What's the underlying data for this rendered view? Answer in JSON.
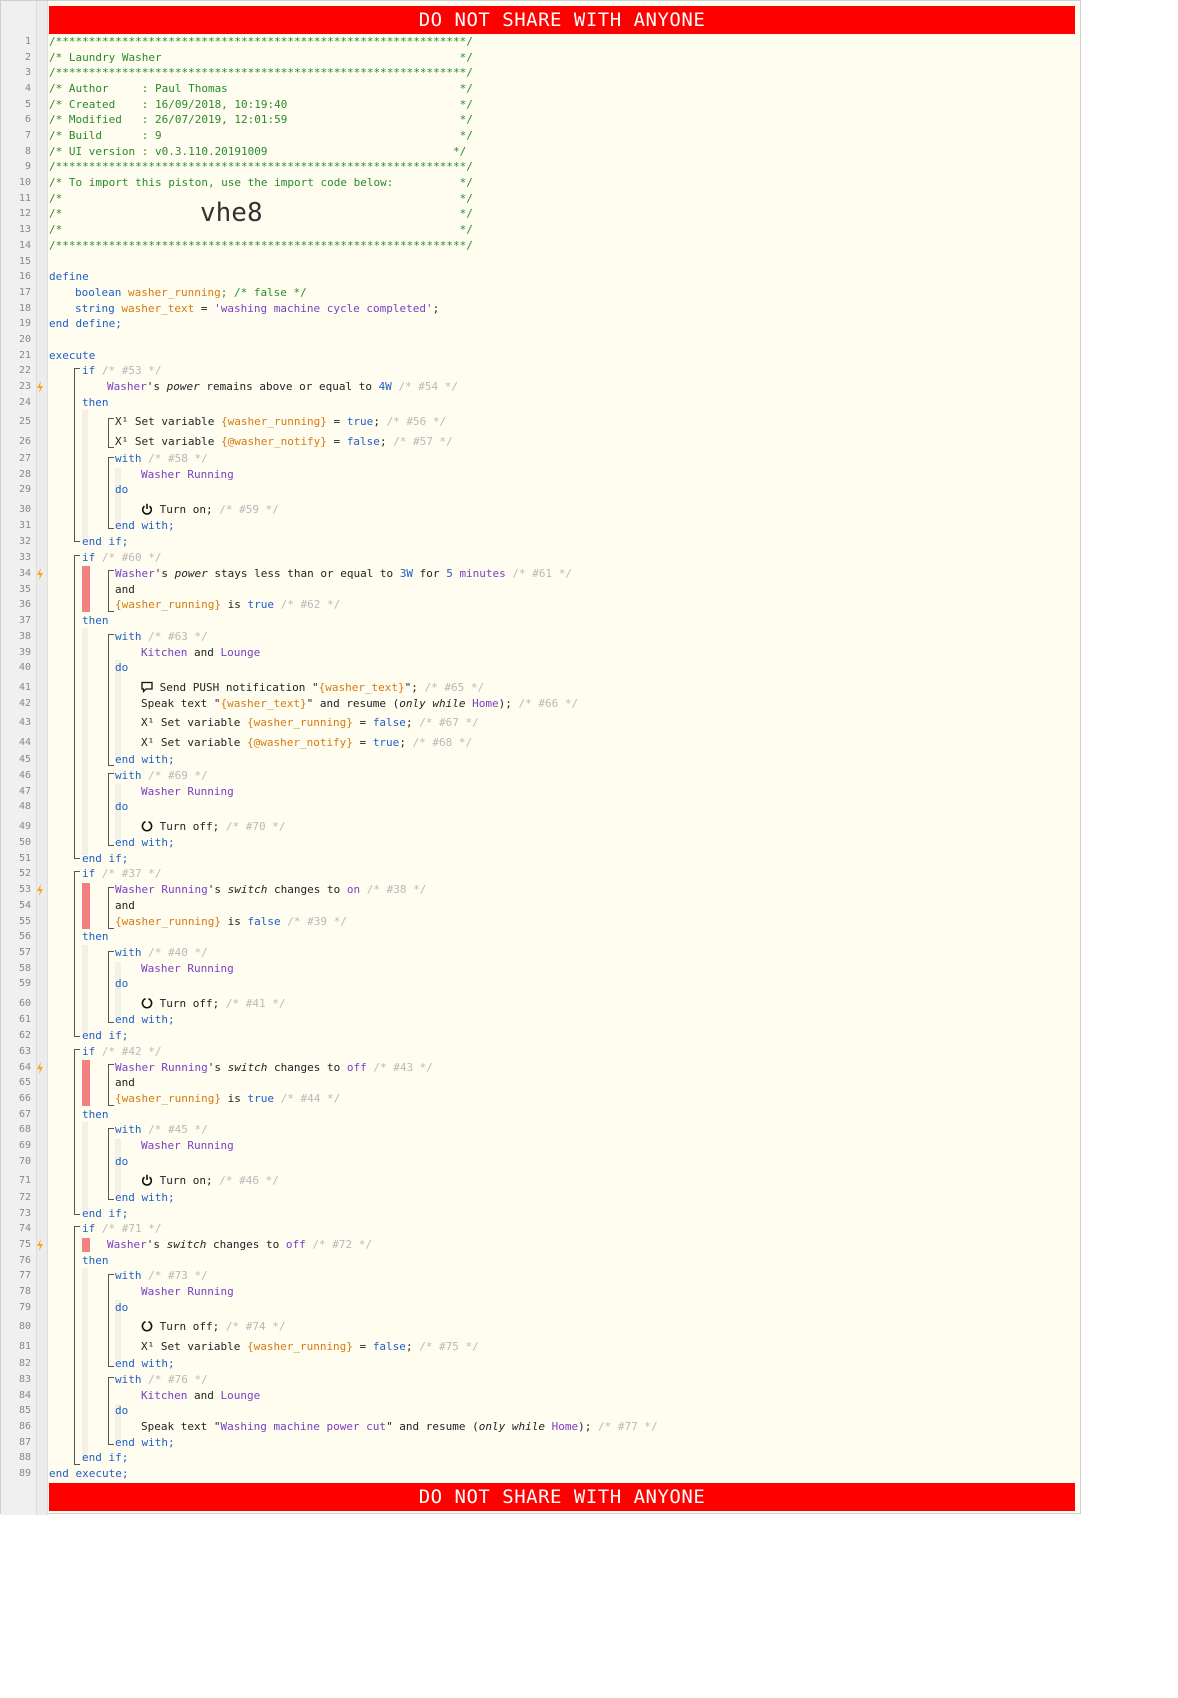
{
  "banner": {
    "text": "DO NOT SHARE WITH ANYONE"
  },
  "import_code": "vhe8",
  "line_numbers": [
    "1",
    "2",
    "3",
    "4",
    "5",
    "6",
    "7",
    "8",
    "9",
    "10",
    "11",
    "12",
    "13",
    "14",
    "15",
    "16",
    "17",
    "18",
    "19",
    "20",
    "21",
    "22",
    "23",
    "24",
    "25",
    "26",
    "27",
    "28",
    "29",
    "30",
    "31",
    "32",
    "33",
    "34",
    "35",
    "36",
    "37",
    "38",
    "39",
    "40",
    "41",
    "42",
    "43",
    "44",
    "45",
    "46",
    "47",
    "48",
    "49",
    "50",
    "51",
    "52",
    "53",
    "54",
    "55",
    "56",
    "57",
    "58",
    "59",
    "60",
    "61",
    "62",
    "63",
    "64",
    "65",
    "66",
    "67",
    "68",
    "69",
    "70",
    "71",
    "72",
    "73",
    "74",
    "75",
    "76",
    "77",
    "78",
    "79",
    "80",
    "81",
    "82",
    "83",
    "84",
    "85",
    "86",
    "87",
    "88",
    "89"
  ],
  "header": {
    "border": "/**************************************************************/",
    "title": "/* Laundry Washer                                             */",
    "author": "/* Author     : Paul Thomas                                   */",
    "created": "/* Created    : 16/09/2018, 10:19:40                          */",
    "modified": "/* Modified   : 26/07/2019, 12:01:59                          */",
    "build": "/* Build      : 9                                             */",
    "ui_version": "/* UI version : v0.3.110.20191009                            */",
    "import_note": "/* To import this piston, use the import code below:          */",
    "blank": "/*                                                            */"
  },
  "code": {
    "define": "define",
    "boolean": "boolean",
    "washer_running": "washer_running",
    "semi_false_comment": "; /* false */",
    "string": "string",
    "washer_text": "washer_text",
    "eq": " = ",
    "washer_text_value": "'washing machine cycle completed'",
    "semi": ";",
    "end_define": "end define;",
    "execute": "execute",
    "end_execute": "end execute;",
    "if": "if",
    "then": "then",
    "end_if": "end if;",
    "with": "with",
    "do": "do",
    "end_with": "end with;",
    "and": "and",
    "washer": "Washer",
    "poss": "'s ",
    "power": "power",
    "switch": "switch",
    "remains_above": " remains above or equal to ",
    "stays_less": " stays less than or equal to ",
    "for": " for ",
    "five": "5",
    "minutes": "minutes",
    "w4": "4W",
    "w3": "3W",
    "set_variable": " Set variable ",
    "v_washer_running": "{washer_running}",
    "v_washer_notify": "{@washer_notify}",
    "v_washer_text": "{washer_text}",
    "true": "true",
    "false": "false",
    "washer_running_dev": "Washer Running",
    "kitchen": "Kitchen",
    "lounge": "Lounge",
    "turn_on": " Turn on;",
    "turn_off": " Turn off;",
    "send_push": " Send PUSH notification \"",
    "close_quote_semi": "\";",
    "speak_text": "Speak text \"",
    "resume": "\" and resume (",
    "only_while": "only while",
    "home": "Home",
    "close_paren": ");",
    "is": " is ",
    "changes_to": " changes to ",
    "on": "on",
    "off": "off",
    "power_cut": "Washing machine power cut"
  },
  "comments": {
    "c53": "/* #53 */",
    "c54": "/* #54 */",
    "c56": "/* #56 */",
    "c57": "/* #57 */",
    "c58": "/* #58 */",
    "c59": "/* #59 */",
    "c60": "/* #60 */",
    "c61": "/* #61 */",
    "c62": "/* #62 */",
    "c63": "/* #63 */",
    "c65": "/* #65 */",
    "c66": "/* #66 */",
    "c67": "/* #67 */",
    "c68": "/* #68 */",
    "c69": "/* #69 */",
    "c70": "/* #70 */",
    "c37": "/* #37 */",
    "c38": "/* #38 */",
    "c39": "/* #39 */",
    "c40": "/* #40 */",
    "c41": "/* #41 */",
    "c42": "/* #42 */",
    "c43": "/* #43 */",
    "c44": "/* #44 */",
    "c45": "/* #45 */",
    "c46": "/* #46 */",
    "c71": "/* #71 */",
    "c72": "/* #72 */",
    "c73": "/* #73 */",
    "c74": "/* #74 */",
    "c75": "/* #75 */",
    "c76": "/* #76 */",
    "c77": "/* #77 */"
  },
  "icons": {
    "trigger": "lightning-bolt-icon",
    "power_on": "power-icon",
    "power_off": "power-off-icon",
    "variable": "variable-icon",
    "message": "speech-bubble-icon"
  },
  "colors": {
    "banner": "#ff0000",
    "keyword": "#2060c8",
    "variable": "#d67a10",
    "device": "#7b3fc4",
    "trigger": "#f5a623",
    "condition_bar": "#f28080"
  }
}
